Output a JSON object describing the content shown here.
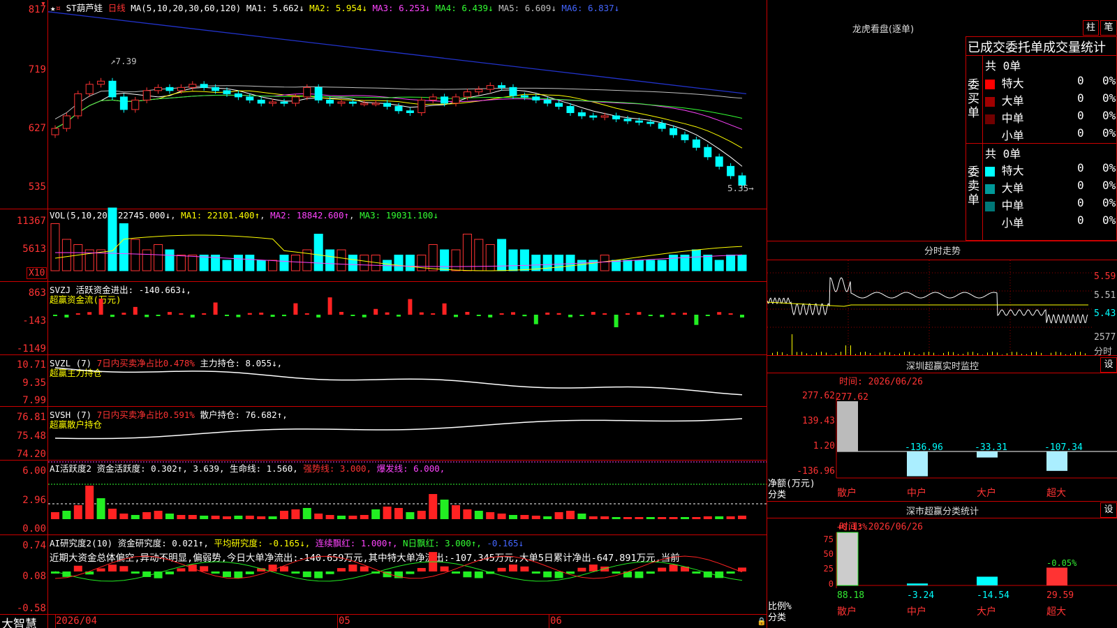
{
  "chart": {
    "stock_name": "ST葫芦娃",
    "period": "日线",
    "ma_label": "MA(5,10,20,30,60,120)",
    "ma_values": [
      {
        "k": "MA1:",
        "v": "5.662↓",
        "c": "#fff"
      },
      {
        "k": "MA2:",
        "v": "5.954↓",
        "c": "#ffff00"
      },
      {
        "k": "MA3:",
        "v": "6.253↓",
        "c": "#ff44ff"
      },
      {
        "k": "MA4:",
        "v": "6.439↓",
        "c": "#33ff33"
      },
      {
        "k": "MA5:",
        "v": "6.609↓",
        "c": "#c0c0c0"
      },
      {
        "k": "MA6:",
        "v": "6.837↓",
        "c": "#4466ff"
      }
    ],
    "price_axis": [
      "817",
      "719",
      "627",
      "535"
    ],
    "high_label": "7.39",
    "low_label": "5.35",
    "vol": {
      "label": "VOL(5,10,20)",
      "value": "22745.000↓",
      "ma1": "MA1: 22101.400↑",
      "ma2": "MA2: 18842.600↑",
      "ma3": "MA3: 19031.100↓",
      "axis": [
        "11367",
        "5613"
      ],
      "unit": "X10"
    },
    "svzj": {
      "label": "SVZJ",
      "text": "活跃资金进出: -140.663↓,",
      "sub": "超赢资金流(万元)",
      "axis": [
        "863",
        "-143",
        "-1149"
      ]
    },
    "svzl": {
      "label": "SVZL (7)",
      "text": "7日内买卖净占比0.478%",
      "text2": "主力持仓: 8.055↓,",
      "sub": "超赢主力持仓",
      "axis": [
        "10.71",
        "9.35",
        "7.99"
      ]
    },
    "svsh": {
      "label": "SVSH (7)",
      "text": "7日内买卖净占比0.591%",
      "text2": "散户持仓: 76.682↑,",
      "sub": "超赢散户持仓",
      "axis": [
        "76.81",
        "75.48",
        "74.20"
      ]
    },
    "ai1": {
      "label": "AI活跃度2",
      "t1": "资金活跃度: 0.302↑,",
      "t2": "3.639,",
      "t3": "生命线: 1.560,",
      "t4": "强势线: 3.000,",
      "t5": "爆发线: 6.000,",
      "axis": [
        "6.00",
        "2.96",
        "0.00"
      ]
    },
    "ai2": {
      "label": "AI研究度2(10)",
      "t1": "资金研究度: 0.021↑,",
      "t2": "平均研究度: -0.165↓,",
      "t3": "连续飘红: 1.000↑,",
      "t4": "N日飘红: 3.000↑,",
      "t5": "-0.165↓",
      "desc": "近期大资金总体偏空,异动不明显,偏弱势,今日大单净流出:-140.659万元,其中特大单净流出:-107.345万元,大单5日累计净出-647.891万元,当前",
      "axis": [
        "0.74",
        "0.08",
        "-0.58"
      ]
    },
    "dates": [
      "2026/04",
      "05",
      "06"
    ],
    "brand": "大智慧"
  },
  "right": {
    "lhb_title": "龙虎看盘(逐单)",
    "btn_zhu": "柱",
    "btn_bi": "笔",
    "order_header": "已成交委托单成交量统计",
    "buy_side": "委买单",
    "sell_side": "委卖单",
    "buy_total": "共 0单",
    "sell_total": "共 0单",
    "buy_rows": [
      {
        "label": "特大",
        "color": "#ff0000",
        "n": "0",
        "p": "0%"
      },
      {
        "label": "大单",
        "color": "#a00000",
        "n": "0",
        "p": "0%"
      },
      {
        "label": "中单",
        "color": "#700000",
        "n": "0",
        "p": "0%"
      },
      {
        "label": "小单",
        "color": "#000",
        "n": "0",
        "p": "0%"
      }
    ],
    "sell_rows": [
      {
        "label": "特大",
        "color": "#00ffff",
        "n": "0",
        "p": "0%"
      },
      {
        "label": "大单",
        "color": "#009999",
        "n": "0",
        "p": "0%"
      },
      {
        "label": "中单",
        "color": "#007777",
        "n": "0",
        "p": "0%"
      },
      {
        "label": "小单",
        "color": "#000",
        "n": "0",
        "p": "0%"
      }
    ],
    "intraday_title": "分时走势",
    "intraday_axis": [
      "5.59",
      "5.51",
      "5.43"
    ],
    "intraday_vol": "2577",
    "intraday_vol_unit": "分时",
    "monitor": {
      "title": "深圳超赢实时监控",
      "btn": "设",
      "time": "时间: 2026/06/26",
      "axis": [
        "277.62",
        "139.43",
        "1.20",
        "-136.96"
      ],
      "ylabel": "净额(万元)",
      "xlabel": "分类",
      "bars": [
        {
          "cat": "散户",
          "value": 277.62,
          "label": "277.62"
        },
        {
          "cat": "中户",
          "value": -136.96,
          "label": "-136.96"
        },
        {
          "cat": "大户",
          "value": -33.31,
          "label": "-33.31"
        },
        {
          "cat": "超大",
          "value": -107.34,
          "label": "-107.34"
        }
      ]
    },
    "classify": {
      "title": "深市超赢分类统计",
      "btn": "设",
      "time": "时间: 2026/06/26",
      "axis": [
        "75",
        "50",
        "25",
        "0"
      ],
      "ylabel": "比例%",
      "xlabel": "分类",
      "top1": "+0.13%",
      "top4": "-0.05%",
      "bars": [
        {
          "cat": "散户",
          "value": 88.18,
          "label": "88.18"
        },
        {
          "cat": "中户",
          "value": 3.24,
          "label": "-3.24"
        },
        {
          "cat": "大户",
          "value": 14.54,
          "label": "-14.54"
        },
        {
          "cat": "超大",
          "value": 29.59,
          "label": "29.59"
        }
      ]
    }
  }
}
